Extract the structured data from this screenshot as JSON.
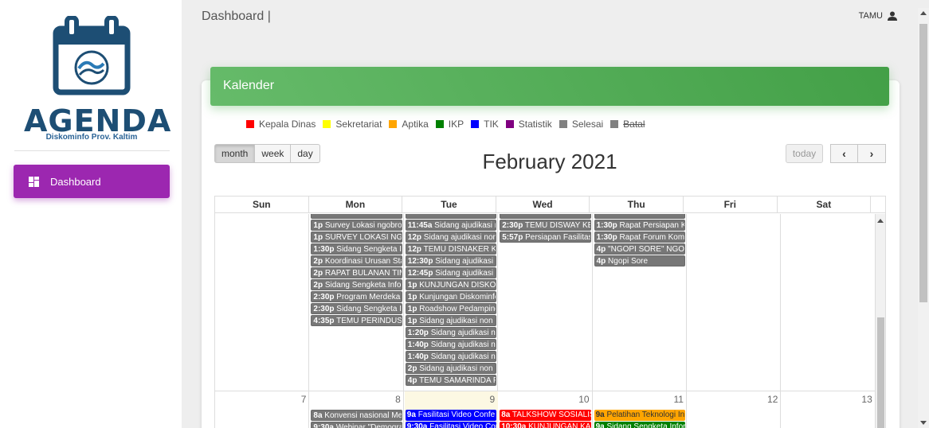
{
  "app": {
    "logo_title": "AGENDA",
    "logo_subtitle": "Diskominfo Prov. Kaltim",
    "breadcrumb": "Dashboard |",
    "user": "TAMU"
  },
  "sidebar": {
    "items": [
      {
        "label": "Dashboard",
        "icon": "dashboard-icon",
        "active": true
      }
    ]
  },
  "card": {
    "title": "Kalender"
  },
  "legend": [
    {
      "label": "Kepala Dinas",
      "color": "#ff0000"
    },
    {
      "label": "Sekretariat",
      "color": "#ffff00"
    },
    {
      "label": "Aptika",
      "color": "#ffa500"
    },
    {
      "label": "IKP",
      "color": "#008000"
    },
    {
      "label": "TIK",
      "color": "#0000ff"
    },
    {
      "label": "Statistik",
      "color": "#800080"
    },
    {
      "label": "Selesai",
      "color": "#808080"
    },
    {
      "label": "Batal",
      "color": "#808080",
      "strike": true
    }
  ],
  "toolbar": {
    "views": [
      "month",
      "week",
      "day"
    ],
    "active_view": "month",
    "title": "February 2021",
    "today_label": "today",
    "prev_label": "‹",
    "next_label": "›"
  },
  "calendar": {
    "weekdays": [
      "Sun",
      "Mon",
      "Tue",
      "Wed",
      "Thu",
      "Fri",
      "Sat"
    ],
    "week1_partial": {
      "mon": [
        {
          "time": "",
          "text": "",
          "color": "gray"
        },
        {
          "time": "1p",
          "text": "Survey Lokasi ngobrol",
          "color": "gray"
        },
        {
          "time": "1p",
          "text": "SURVEY LOKASI NGOBROL",
          "color": "gray"
        },
        {
          "time": "1:30p",
          "text": "Sidang Sengketa Info",
          "color": "gray"
        },
        {
          "time": "2p",
          "text": "Koordinasi Urusan Statistik",
          "color": "gray"
        },
        {
          "time": "2p",
          "text": "RAPAT BULANAN TIM",
          "color": "gray"
        },
        {
          "time": "2p",
          "text": "Sidang Sengketa Informasi",
          "color": "gray"
        },
        {
          "time": "2:30p",
          "text": "Program Merdeka",
          "color": "gray"
        },
        {
          "time": "2:30p",
          "text": "Sidang Sengketa Info",
          "color": "gray"
        },
        {
          "time": "4:35p",
          "text": "TEMU PERINDUSTRIAN",
          "color": "gray"
        }
      ],
      "tue": [
        {
          "time": "",
          "text": "",
          "color": "gray"
        },
        {
          "time": "11:45a",
          "text": "Sidang ajudikasi non",
          "color": "gray"
        },
        {
          "time": "12p",
          "text": "Sidang ajudikasi non",
          "color": "gray"
        },
        {
          "time": "12p",
          "text": "TEMU DISNAKER KE",
          "color": "gray"
        },
        {
          "time": "12:30p",
          "text": "Sidang ajudikasi non",
          "color": "gray"
        },
        {
          "time": "12:45p",
          "text": "Sidang ajudikasi non",
          "color": "gray"
        },
        {
          "time": "1p",
          "text": "KUNJUNGAN DISKOMINFO",
          "color": "gray"
        },
        {
          "time": "1p",
          "text": "Kunjungan Diskominfo",
          "color": "gray"
        },
        {
          "time": "1p",
          "text": "Roadshow Pedampingan",
          "color": "gray"
        },
        {
          "time": "1p",
          "text": "Sidang ajudikasi non",
          "color": "gray"
        },
        {
          "time": "1:20p",
          "text": "Sidang ajudikasi non",
          "color": "gray"
        },
        {
          "time": "1:40p",
          "text": "Sidang ajudikasi non",
          "color": "gray"
        },
        {
          "time": "1:40p",
          "text": "Sidang ajudikasi non",
          "color": "gray"
        },
        {
          "time": "2p",
          "text": "Sidang ajudikasi non",
          "color": "gray"
        },
        {
          "time": "4p",
          "text": "TEMU SAMARINDA P",
          "color": "gray"
        }
      ],
      "wed": [
        {
          "time": "",
          "text": "",
          "color": "gray"
        },
        {
          "time": "2:30p",
          "text": "TEMU DISWAY KE",
          "color": "gray"
        },
        {
          "time": "5:57p",
          "text": "Persiapan Fasilitas",
          "color": "gray"
        }
      ],
      "thu": [
        {
          "time": "",
          "text": "",
          "color": "gray"
        },
        {
          "time": "1:30p",
          "text": "Rapat Persiapan K",
          "color": "gray"
        },
        {
          "time": "1:30p",
          "text": "Rapat Forum Kom",
          "color": "gray"
        },
        {
          "time": "4p",
          "text": "\"NGOPI SORE\" NGOBR",
          "color": "gray"
        },
        {
          "time": "4p",
          "text": "Ngopi Sore",
          "color": "gray"
        }
      ]
    },
    "week2_days": [
      "7",
      "8",
      "9",
      "10",
      "11",
      "12",
      "13"
    ],
    "week2_events": {
      "mon": [
        {
          "time": "8a",
          "text": "Konvensi nasional Me",
          "color": "gray"
        },
        {
          "time": "9:30a",
          "text": "Webinar \"Demografi",
          "color": "gray"
        }
      ],
      "tue": [
        {
          "time": "9a",
          "text": "Fasilitasi Video Confe",
          "color": "blue"
        },
        {
          "time": "9:30a",
          "text": "Fasilitasi Video Con",
          "color": "blue"
        }
      ],
      "wed": [
        {
          "time": "8a",
          "text": "TALKSHOW SOSIALIS",
          "color": "red"
        },
        {
          "time": "10:30a",
          "text": "KUNJUNGAN KA",
          "color": "red"
        }
      ],
      "thu": [
        {
          "time": "9a",
          "text": "Pelatihan Teknologi In",
          "color": "orange"
        },
        {
          "time": "9a",
          "text": "Sidang Sengketa Infor",
          "color": "green"
        }
      ]
    }
  }
}
